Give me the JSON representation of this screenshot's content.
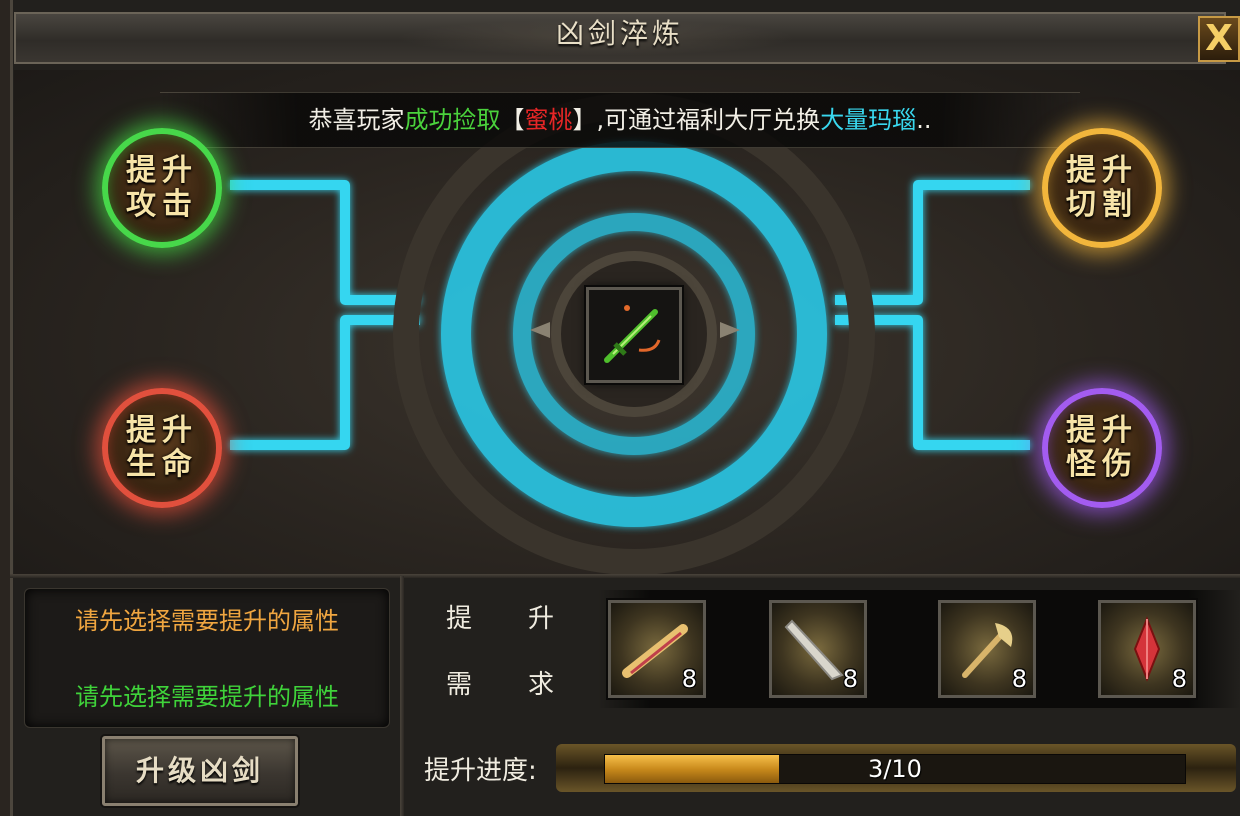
{
  "window": {
    "title": "凶剑淬炼",
    "close_label": "X"
  },
  "notice": {
    "prefix": "恭喜玩家",
    "highlight": "成功捡取",
    "bracket_open": "【",
    "item": "蜜桃",
    "bracket_close": "】",
    "middle": ",可通过福利大厅兑换",
    "reward": "大量玛瑙",
    "suffix": ".."
  },
  "nodes": {
    "attack": {
      "label": "提升攻击",
      "color": "#47d84a"
    },
    "life": {
      "label": "提升生命",
      "color": "#e1503d"
    },
    "cut": {
      "label": "提升切割",
      "color": "#f2b63c"
    },
    "monster_damage": {
      "label": "提升怪伤",
      "color": "#a35cf0"
    }
  },
  "center_item": {
    "icon": "green-sword-icon"
  },
  "hints": {
    "line1": "请先选择需要提升的属性",
    "line2": "请先选择需要提升的属性"
  },
  "upgrade_button": {
    "label": "升级凶剑"
  },
  "requirements": {
    "label_a1": "提",
    "label_a2": "升",
    "label_b1": "需",
    "label_b2": "求",
    "materials": [
      {
        "icon": "golden-scroll-icon",
        "count": "8"
      },
      {
        "icon": "silver-blade-icon",
        "count": "8"
      },
      {
        "icon": "golden-axe-icon",
        "count": "8"
      },
      {
        "icon": "red-crystal-icon",
        "count": "8"
      }
    ]
  },
  "progress": {
    "label": "提升进度:",
    "text": "3/10",
    "fraction": 0.3
  },
  "colors": {
    "glow": "#36d6f0",
    "accent_gold": "#f2b63c"
  }
}
